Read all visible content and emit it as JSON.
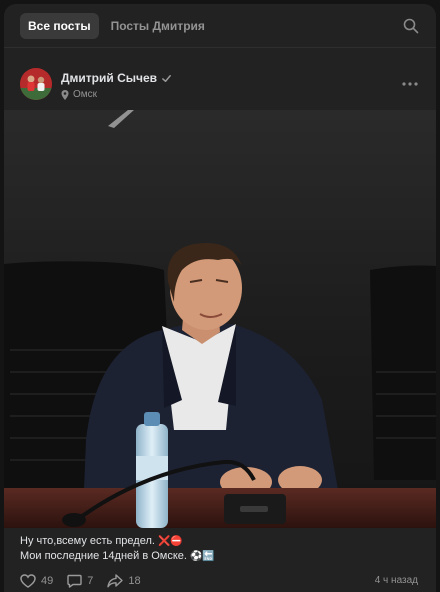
{
  "tabs": {
    "all_posts": "Все посты",
    "author_posts": "Посты Дмитрия"
  },
  "post": {
    "author": "Дмитрий Сычев",
    "location": "Омск",
    "caption_line1": "Ну что,всему есть предел.",
    "caption_line1_emojis": "❌⛔",
    "caption_line2": "Мои последние 14дней в Омске.",
    "caption_line2_emojis": "⚽🔚",
    "likes": "49",
    "comments": "7",
    "shares": "18",
    "time": "4 ч назад"
  },
  "colors": {
    "background": "#222222",
    "text_primary": "#e1e3e6",
    "text_secondary": "#939393",
    "active_tab": "#3a3a3a"
  },
  "icons": {
    "search": "search-icon",
    "verified": "verified-check-icon",
    "pin": "location-pin-icon",
    "more": "more-dots-icon",
    "like": "heart-icon",
    "comment": "comment-icon",
    "share": "share-arrow-icon"
  }
}
